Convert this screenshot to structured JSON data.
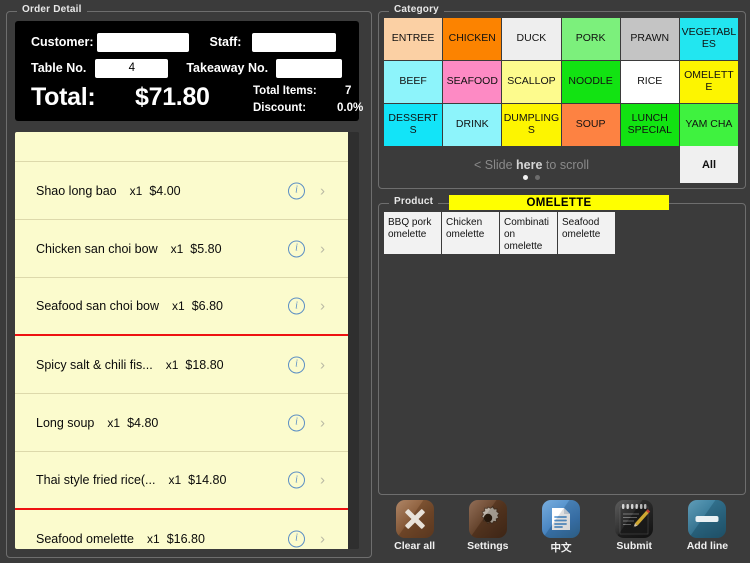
{
  "order_detail": {
    "legend": "Order Detail",
    "fields": {
      "customer_label": "Customer:",
      "customer_value": "",
      "staff_label": "Staff:",
      "staff_value": "",
      "table_label": "Table No.",
      "table_value": "4",
      "takeaway_label": "Takeaway No.",
      "takeaway_value": ""
    },
    "summary": {
      "total_label": "Total:",
      "total_value": "$71.80",
      "total_items_label": "Total Items:",
      "total_items_value": "7",
      "discount_label": "Discount:",
      "discount_value": "0.0%"
    },
    "items": [
      {
        "name": "Shao long bao",
        "qty": "x1",
        "price": "$4.00",
        "course_end": false
      },
      {
        "name": "Chicken san choi bow",
        "qty": "x1",
        "price": "$5.80",
        "course_end": false
      },
      {
        "name": "Seafood san choi bow",
        "qty": "x1",
        "price": "$6.80",
        "course_end": true
      },
      {
        "name": "Spicy salt & chili fis...",
        "qty": "x1",
        "price": "$18.80",
        "course_end": false
      },
      {
        "name": "Long soup",
        "qty": "x1",
        "price": "$4.80",
        "course_end": false
      },
      {
        "name": "Thai style fried rice(...",
        "qty": "x1",
        "price": "$14.80",
        "course_end": true
      },
      {
        "name": "Seafood omelette",
        "qty": "x1",
        "price": "$16.80",
        "course_end": false
      }
    ]
  },
  "category": {
    "legend": "Category",
    "tiles": [
      {
        "label": "ENTREE",
        "color": "#fbd0a4"
      },
      {
        "label": "CHICKEN",
        "color": "#fc8300"
      },
      {
        "label": "DUCK",
        "color": "#eeeeee"
      },
      {
        "label": "PORK",
        "color": "#7cf07c"
      },
      {
        "label": "PRAWN",
        "color": "#c4c4c4"
      },
      {
        "label": "VEGETABLES",
        "color": "#22e6f0"
      },
      {
        "label": "BEEF",
        "color": "#8df4fb"
      },
      {
        "label": "SEAFOOD",
        "color": "#fd8ac4"
      },
      {
        "label": "SCALLOP",
        "color": "#fdfb8d"
      },
      {
        "label": "NOODLE",
        "color": "#12e312"
      },
      {
        "label": "RICE",
        "color": "#ffffff"
      },
      {
        "label": "OMELETTE",
        "color": "#fdf500"
      },
      {
        "label": "DESSERTS",
        "color": "#12e4f8"
      },
      {
        "label": "DRINK",
        "color": "#8df4fb"
      },
      {
        "label": "DUMPLINGS",
        "color": "#fdf500"
      },
      {
        "label": "SOUP",
        "color": "#fd8242"
      },
      {
        "label": "LUNCH SPECIAL",
        "color": "#12e312"
      },
      {
        "label": "YAM CHA",
        "color": "#3ff23f"
      }
    ],
    "scroll_hint_prefix": "< Slide ",
    "scroll_hint_bold": "here",
    "scroll_hint_suffix": " to scroll",
    "all_button": "All",
    "page_dots": 2,
    "active_dot": 0
  },
  "product": {
    "legend": "Product",
    "selected_category": "OMELETTE",
    "tiles": [
      {
        "label": "BBQ pork omelette"
      },
      {
        "label": "Chicken omelette"
      },
      {
        "label": "Combination omelette"
      },
      {
        "label": "Seafood omelette"
      }
    ]
  },
  "toolbar": {
    "buttons": [
      {
        "label": "Clear all",
        "icon": "cross-icon"
      },
      {
        "label": "Settings",
        "icon": "gear-icon"
      },
      {
        "label": "中文",
        "icon": "document-icon"
      },
      {
        "label": "Submit",
        "icon": "notepad-pencil-icon"
      },
      {
        "label": "Add line",
        "icon": "minus-icon"
      }
    ]
  }
}
